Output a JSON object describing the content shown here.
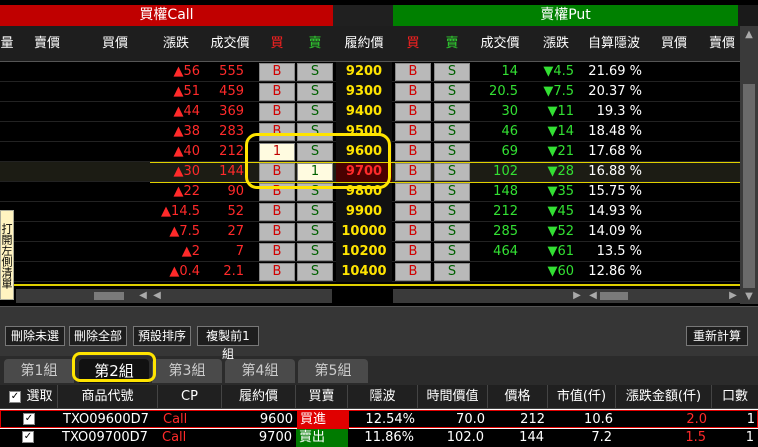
{
  "chain": {
    "call_header": "買權Call",
    "put_header": "賣權Put",
    "columns": {
      "c0": "量",
      "c1": "賣價",
      "c2": "買價",
      "c3": "漲跌",
      "c4": "成交價",
      "c5": "買",
      "c6": "賣",
      "c7": "履約價",
      "c8": "買",
      "c9": "賣",
      "c10": "成交價",
      "c11": "漲跌",
      "c12": "自算隱波",
      "c13": "買價",
      "c14": "賣價"
    },
    "side_tab": "打開左側清單",
    "rows": [
      {
        "call_chg": "▲56",
        "call_price": "555",
        "b": "B",
        "s": "S",
        "strike": "9200",
        "pb": "B",
        "ps": "S",
        "put_price": "14",
        "put_chg": "▼4.5",
        "iv": "21.69 %"
      },
      {
        "call_chg": "▲51",
        "call_price": "459",
        "b": "B",
        "s": "S",
        "strike": "9300",
        "pb": "B",
        "ps": "S",
        "put_price": "20.5",
        "put_chg": "▼7.5",
        "iv": "20.37 %"
      },
      {
        "call_chg": "▲44",
        "call_price": "369",
        "b": "B",
        "s": "S",
        "strike": "9400",
        "pb": "B",
        "ps": "S",
        "put_price": "30",
        "put_chg": "▼11",
        "iv": "19.3 %"
      },
      {
        "call_chg": "▲38",
        "call_price": "283",
        "b": "B",
        "s": "S",
        "strike": "9500",
        "pb": "B",
        "ps": "S",
        "put_price": "46",
        "put_chg": "▼14",
        "iv": "18.48 %"
      },
      {
        "call_chg": "▲40",
        "call_price": "212",
        "b": "1",
        "s": "S",
        "strike": "9600",
        "pb": "B",
        "ps": "S",
        "put_price": "69",
        "put_chg": "▼21",
        "iv": "17.68 %"
      },
      {
        "call_chg": "▲30",
        "call_price": "144",
        "b": "B",
        "s": "1",
        "strike": "9700",
        "pb": "B",
        "ps": "S",
        "put_price": "102",
        "put_chg": "▼28",
        "iv": "16.88 %"
      },
      {
        "call_chg": "▲22",
        "call_price": "90",
        "b": "B",
        "s": "S",
        "strike": "9800",
        "pb": "B",
        "ps": "S",
        "put_price": "148",
        "put_chg": "▼35",
        "iv": "15.75 %"
      },
      {
        "call_chg": "▲14.5",
        "call_price": "52",
        "b": "B",
        "s": "S",
        "strike": "9900",
        "pb": "B",
        "ps": "S",
        "put_price": "212",
        "put_chg": "▼45",
        "iv": "14.93 %"
      },
      {
        "call_chg": "▲7.5",
        "call_price": "27",
        "b": "B",
        "s": "S",
        "strike": "10000",
        "pb": "B",
        "ps": "S",
        "put_price": "285",
        "put_chg": "▼52",
        "iv": "14.09 %"
      },
      {
        "call_chg": "▲2",
        "call_price": "7",
        "b": "B",
        "s": "S",
        "strike": "10200",
        "pb": "B",
        "ps": "S",
        "put_price": "464",
        "put_chg": "▼61",
        "iv": "13.5 %"
      },
      {
        "call_chg": "▲0.4",
        "call_price": "2.1",
        "b": "B",
        "s": "S",
        "strike": "10400",
        "pb": "B",
        "ps": "S",
        "put_price": "",
        "put_chg": "▼60",
        "iv": "12.86 %"
      }
    ]
  },
  "toolbar": {
    "delete_unselected": "刪除未選",
    "delete_all": "刪除全部",
    "default_sort": "預設排序",
    "copy_prev": "複製前1組",
    "recalc": "重新計算"
  },
  "group_tabs": [
    "第1組",
    "第2組",
    "第3組",
    "第4組",
    "第5組"
  ],
  "grid": {
    "headers": [
      "選取",
      "商品代號",
      "CP",
      "履約價",
      "買賣",
      "隱波",
      "時間價值",
      "價格",
      "市值(仟)",
      "漲跌金額(仟)",
      "口數"
    ],
    "rows": [
      {
        "select": "✓",
        "code": "TXO09600D7",
        "cp": "Call",
        "strike": "9600",
        "side": "買進",
        "iv": "12.54%",
        "time_value": "70.0",
        "price": "212",
        "mkt_value": "10.6",
        "chg_amount": "2.0",
        "qty": "1"
      },
      {
        "select": "✓",
        "code": "TXO09700D7",
        "cp": "Call",
        "strike": "9700",
        "side": "賣出",
        "iv": "11.86%",
        "time_value": "102.0",
        "price": "144",
        "mkt_value": "7.2",
        "chg_amount": "1.5",
        "qty": "1"
      }
    ]
  },
  "colors": {
    "call_red": "#c00000",
    "put_green": "#008000",
    "highlight_yellow": "#ffe400"
  }
}
